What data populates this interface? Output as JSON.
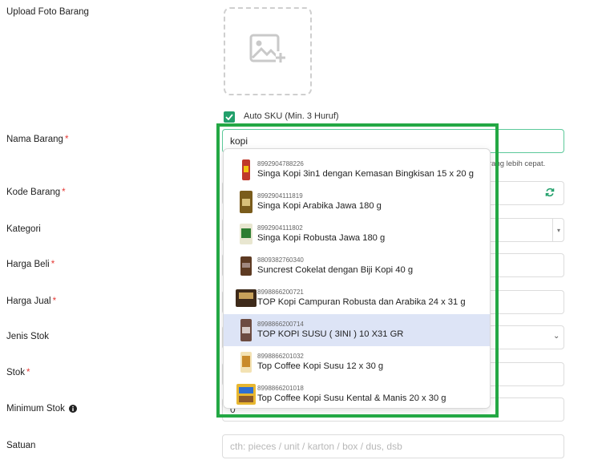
{
  "labels": {
    "upload": "Upload Foto Barang",
    "nama": "Nama Barang",
    "kode": "Kode Barang",
    "kategori": "Kategori",
    "harga_beli": "Harga Beli",
    "harga_jual": "Harga Jual",
    "jenis_stok": "Jenis Stok",
    "stok": "Stok",
    "minimum_stok": "Minimum Stok",
    "satuan": "Satuan",
    "required_mark": "*"
  },
  "auto_sku": {
    "label": "Auto SKU (Min. 3 Huruf)",
    "checked": true
  },
  "nama_input": {
    "value": "kopi"
  },
  "hint_text": "rang lebih cepat.",
  "minimum_stok_value": "0",
  "satuan_input": {
    "placeholder": "cth: pieces / unit / karton / box / dus, dsb"
  },
  "dropdown": {
    "items": [
      {
        "sku": "8992904788226",
        "name": "Singa Kopi 3in1 dengan Kemasan Bingkisan 15 x 20 g",
        "color": "#c0392b"
      },
      {
        "sku": "8992904111819",
        "name": "Singa Kopi Arabika Jawa 180 g",
        "color": "#7a5c1c"
      },
      {
        "sku": "8992904111802",
        "name": "Singa Kopi Robusta Jawa 180 g",
        "color": "#2e7d32"
      },
      {
        "sku": "8809382760340",
        "name": "Suncrest Cokelat dengan Biji Kopi 40 g",
        "color": "#5d3a22"
      },
      {
        "sku": "8998866200721",
        "name": "TOP Kopi Campuran Robusta dan Arabika 24 x 31 g",
        "color": "#3e2a1a"
      },
      {
        "sku": "8998866200714",
        "name": "TOP KOPI SUSU ( 3INI ) 10 X31 GR",
        "color": "#6d4c41",
        "active": true
      },
      {
        "sku": "8998866201032",
        "name": "Top Coffee Kopi Susu 12 x 30 g",
        "color": "#c98b2a"
      },
      {
        "sku": "8998866201018",
        "name": "Top Coffee Kopi Susu Kental & Manis 20 x 30 g",
        "color": "#e8b730"
      }
    ]
  },
  "colors": {
    "accent": "#22a06b",
    "highlight_frame": "#23a844",
    "active_row": "#dde4f6"
  }
}
